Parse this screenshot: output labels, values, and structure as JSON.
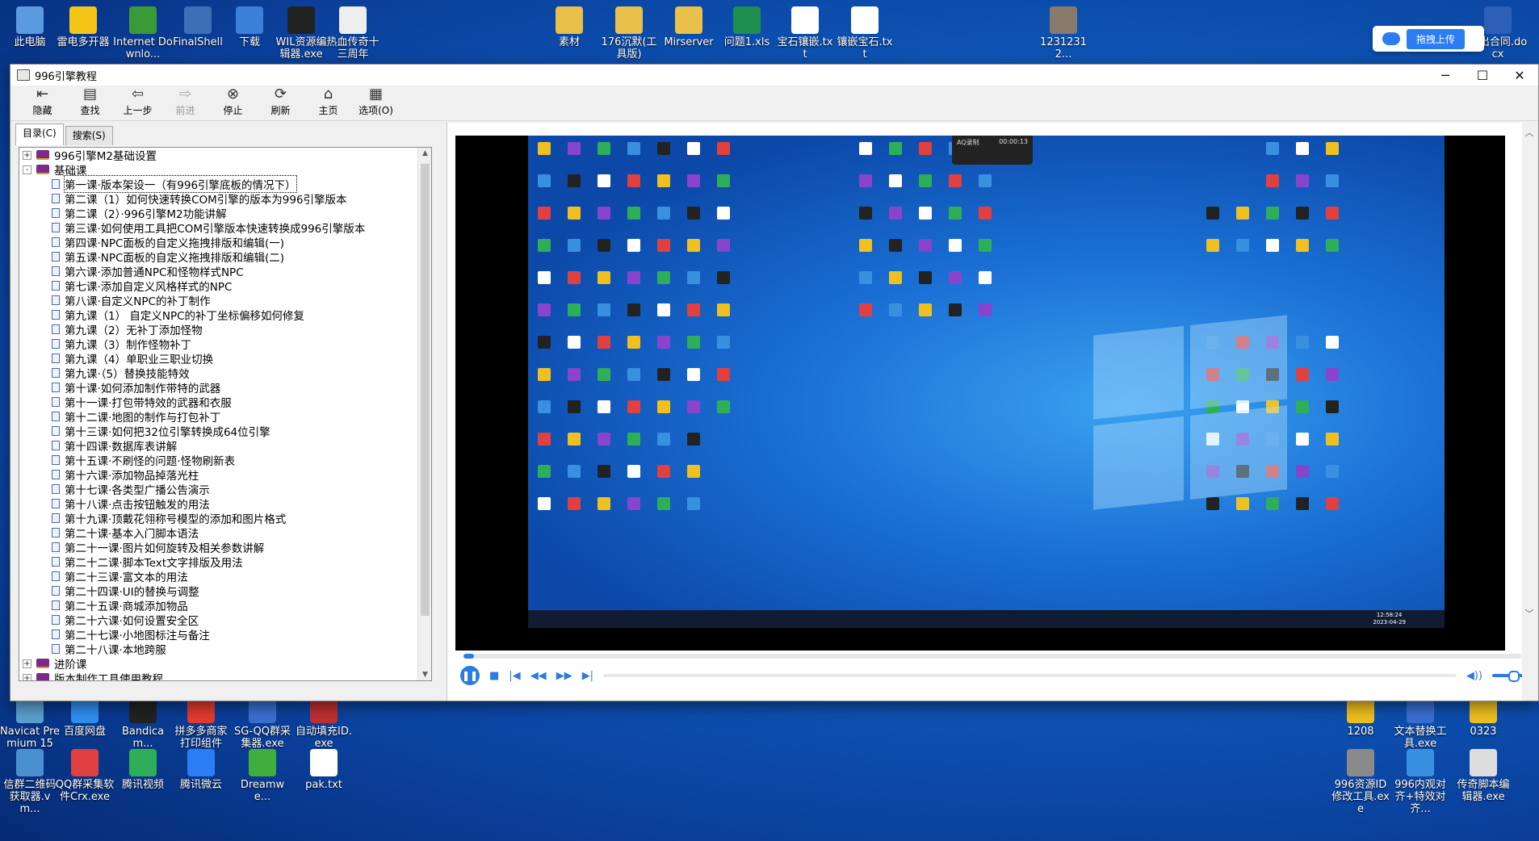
{
  "desktop": {
    "top_icons": [
      {
        "label": "此电脑",
        "icon": "computer-icon",
        "color": "#5a9be0"
      },
      {
        "label": "雷电多开器",
        "icon": "ldplayer-icon",
        "color": "#f5c518"
      },
      {
        "label": "Internet Downlo...",
        "icon": "idm-icon",
        "color": "#3a9a3a"
      },
      {
        "label": "FinalShell",
        "icon": "finalshell-icon",
        "color": "#3b6fb6"
      },
      {
        "label": "下载",
        "icon": "download-folder-icon",
        "color": "#3a7fd8"
      },
      {
        "label": "WIL资源编辑器.exe",
        "icon": "wil-editor-icon",
        "color": "#222222"
      },
      {
        "label": "热血传奇十三周年",
        "icon": "file-icon",
        "color": "#eeeeee"
      },
      {
        "label": "素材",
        "icon": "folder-icon",
        "color": "#e8c04a"
      },
      {
        "label": "176沉默(工具版)",
        "icon": "folder-icon",
        "color": "#e8c04a"
      },
      {
        "label": "Mirserver",
        "icon": "folder-icon",
        "color": "#e8c04a"
      },
      {
        "label": "问题1.xls",
        "icon": "excel-icon",
        "color": "#1e8f4e"
      },
      {
        "label": "宝石镶嵌.txt",
        "icon": "txt-icon",
        "color": "#ffffff"
      },
      {
        "label": "镶嵌宝石.txt",
        "icon": "txt-icon",
        "color": "#ffffff"
      },
      {
        "label": "12312312...",
        "icon": "image-icon",
        "color": "#8a7a6a"
      },
      {
        "label": "共出合同.docx",
        "icon": "word-icon",
        "color": "#2b5fb8"
      }
    ],
    "bottom_icons": [
      {
        "label": "Navicat Premium 15",
        "icon": "navicat-icon",
        "color": "#5aa0d0"
      },
      {
        "label": "百度网盘",
        "icon": "baidu-pan-icon",
        "color": "#2f8ef0"
      },
      {
        "label": "Bandicam...",
        "icon": "bandicam-icon",
        "color": "#222222"
      },
      {
        "label": "拼多多商家打印组件",
        "icon": "pdd-icon",
        "color": "#e33b2e"
      },
      {
        "label": "SG-QQ群采集器.exe",
        "icon": "sg-icon",
        "color": "#3a6fd0"
      },
      {
        "label": "自动填充ID.exe",
        "icon": "app-icon",
        "color": "#c03030"
      },
      {
        "label": "1208",
        "icon": "app-icon",
        "color": "#f0c020"
      },
      {
        "label": "文本替换工具.exe",
        "icon": "app-icon",
        "color": "#3a6fd0"
      },
      {
        "label": "0323",
        "icon": "app-icon",
        "color": "#f0c020"
      },
      {
        "label": "信群二维码获取器.vm...",
        "icon": "app-icon",
        "color": "#4a90d0"
      },
      {
        "label": "QQ群采集软件Crx.exe",
        "icon": "app-icon",
        "color": "#e04040"
      },
      {
        "label": "腾讯视频",
        "icon": "tencent-video-icon",
        "color": "#2fae5a"
      },
      {
        "label": "腾讯微云",
        "icon": "weiyun-icon",
        "color": "#2a7df2"
      },
      {
        "label": "Dreamwe...",
        "icon": "dreamweaver-icon",
        "color": "#3fae3f"
      },
      {
        "label": "pak.txt",
        "icon": "txt-icon",
        "color": "#ffffff"
      },
      {
        "label": "996资源ID修改工具.exe",
        "icon": "app-icon",
        "color": "#8a8a8a"
      },
      {
        "label": "996内观对齐+特效对齐...",
        "icon": "app-icon",
        "color": "#3a90e0"
      },
      {
        "label": "传奇脚本编辑器.exe",
        "icon": "app-icon",
        "color": "#dddddd"
      }
    ],
    "upload_button": "拖拽上传"
  },
  "window": {
    "title": "996引擎教程",
    "controls": {
      "minimize": "─",
      "maximize": "☐",
      "close": "✕"
    },
    "toolbar": [
      {
        "label": "隐藏",
        "icon": "hide-icon",
        "glyph": "⇤",
        "disabled": false
      },
      {
        "label": "查找",
        "icon": "find-icon",
        "glyph": "▤",
        "disabled": false
      },
      {
        "label": "上一步",
        "icon": "back-icon",
        "glyph": "⇦",
        "disabled": false
      },
      {
        "label": "前进",
        "icon": "forward-icon",
        "glyph": "⇨",
        "disabled": true
      },
      {
        "label": "停止",
        "icon": "stop-icon",
        "glyph": "⊗",
        "disabled": false
      },
      {
        "label": "刷新",
        "icon": "refresh-icon",
        "glyph": "⟳",
        "disabled": false
      },
      {
        "label": "主页",
        "icon": "home-icon",
        "glyph": "⌂",
        "disabled": false
      },
      {
        "label": "选项(O)",
        "icon": "options-icon",
        "glyph": "▦",
        "disabled": false
      }
    ],
    "tabs": [
      {
        "label": "目录(C)",
        "active": true
      },
      {
        "label": "搜索(S)",
        "active": false
      }
    ],
    "tree": [
      {
        "type": "book",
        "expander": "+",
        "label": "996引擎M2基础设置"
      },
      {
        "type": "book",
        "expander": "-",
        "label": "基础课"
      },
      {
        "type": "page",
        "label": "第一课·版本架设一（有996引擎底板的情况下）",
        "selected": true
      },
      {
        "type": "page",
        "label": "第二课（1）如何快速转换COM引擎的版本为996引擎版本"
      },
      {
        "type": "page",
        "label": "第二课（2）·996引擎M2功能讲解"
      },
      {
        "type": "page",
        "label": "第三课·如何使用工具把COM引擎版本快速转换成996引擎版本"
      },
      {
        "type": "page",
        "label": "第四课·NPC面板的自定义拖拽排版和编辑(一)"
      },
      {
        "type": "page",
        "label": "第五课·NPC面板的自定义拖拽排版和编辑(二)"
      },
      {
        "type": "page",
        "label": "第六课·添加普通NPC和怪物样式NPC"
      },
      {
        "type": "page",
        "label": "第七课·添加自定义风格样式的NPC"
      },
      {
        "type": "page",
        "label": "第八课·自定义NPC的补丁制作"
      },
      {
        "type": "page",
        "label": "第九课（1） 自定义NPC的补丁坐标偏移如何修复"
      },
      {
        "type": "page",
        "label": "第九课（2）无补丁添加怪物"
      },
      {
        "type": "page",
        "label": "第九课（3）制作怪物补丁"
      },
      {
        "type": "page",
        "label": "第九课（4）单职业三职业切换"
      },
      {
        "type": "page",
        "label": "第九课·（5）替换技能特效"
      },
      {
        "type": "page",
        "label": "第十课·如何添加制作带特的武器"
      },
      {
        "type": "page",
        "label": "第十一课·打包带特效的武器和衣服"
      },
      {
        "type": "page",
        "label": "第十二课·地图的制作与打包补丁"
      },
      {
        "type": "page",
        "label": "第十三课·如何把32位引擎转换成64位引擎"
      },
      {
        "type": "page",
        "label": "第十四课·数据库表讲解"
      },
      {
        "type": "page",
        "label": "第十五课·不刷怪的问题·怪物刷新表"
      },
      {
        "type": "page",
        "label": "第十六课·添加物品掉落光柱"
      },
      {
        "type": "page",
        "label": "第十七课·各类型广播公告演示"
      },
      {
        "type": "page",
        "label": "第十八课·点击按钮触发的用法"
      },
      {
        "type": "page",
        "label": "第十九课·顶戴花翎称号模型的添加和图片格式"
      },
      {
        "type": "page",
        "label": "第二十课·基本入门脚本语法"
      },
      {
        "type": "page",
        "label": "第二十一课·图片如何旋转及相关参数讲解"
      },
      {
        "type": "page",
        "label": "第二十二课·脚本Text文字排版及用法"
      },
      {
        "type": "page",
        "label": "第二十三课·富文本的用法"
      },
      {
        "type": "page",
        "label": "第二十四课·UI的替换与调整"
      },
      {
        "type": "page",
        "label": "第二十五课·商城添加物品"
      },
      {
        "type": "page",
        "label": "第二十六课·如何设置安全区"
      },
      {
        "type": "page",
        "label": "第二十七课·小地图标注与备注"
      },
      {
        "type": "page",
        "label": "第二十八课·本地跨服"
      },
      {
        "type": "book",
        "expander": "+",
        "label": "进阶课"
      },
      {
        "type": "book",
        "expander": "+",
        "label": "版本制作工具使用教程"
      }
    ],
    "video": {
      "recorder_label": "AQ录制",
      "recorder_time": "00:00:13",
      "clock_time": "12:58:24",
      "clock_date": "2023-04-29",
      "progress": 0.01,
      "volume": 0.7
    }
  }
}
